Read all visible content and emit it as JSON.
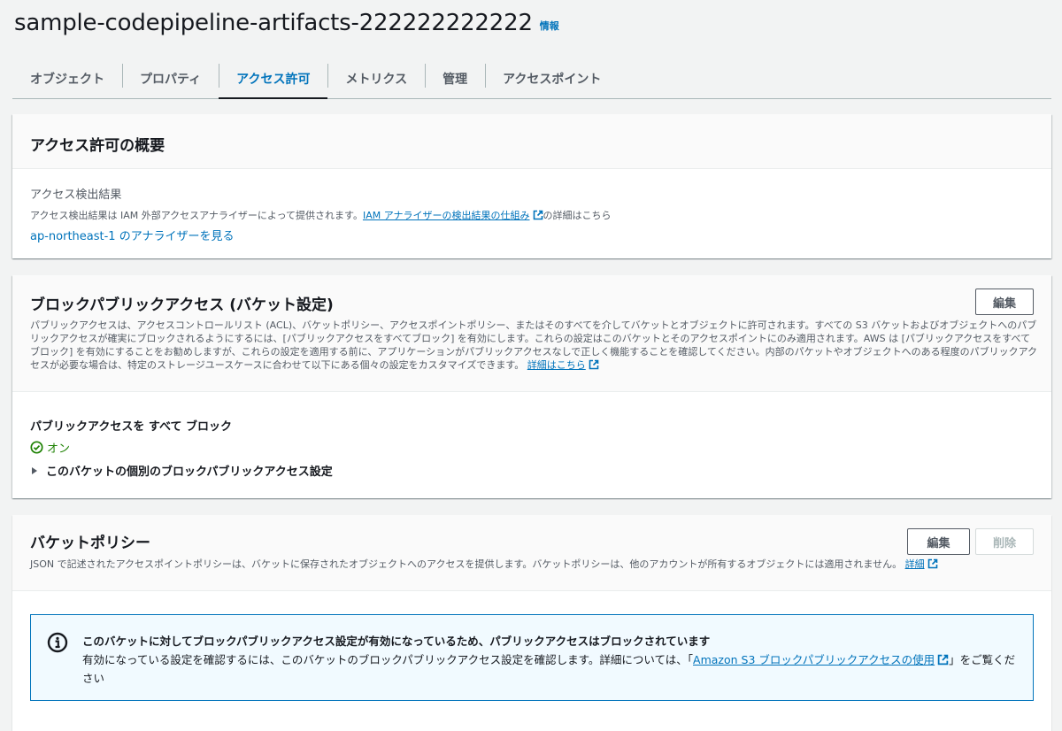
{
  "header": {
    "title": "sample-codepipeline-artifacts-222222222222",
    "info": "情報"
  },
  "tabs": [
    {
      "label": "オブジェクト",
      "active": false
    },
    {
      "label": "プロパティ",
      "active": false
    },
    {
      "label": "アクセス許可",
      "active": true
    },
    {
      "label": "メトリクス",
      "active": false
    },
    {
      "label": "管理",
      "active": false
    },
    {
      "label": "アクセスポイント",
      "active": false
    }
  ],
  "overview": {
    "title": "アクセス許可の概要",
    "findings_label": "アクセス検出結果",
    "findings_desc_prefix": "アクセス検出結果は IAM 外部アクセスアナライザーによって提供されます。",
    "findings_desc_link": "IAM アナライザーの検出結果の仕組み",
    "findings_desc_suffix": "の詳細はこちら",
    "analyzer_link": "ap-northeast-1 のアナライザーを見る"
  },
  "bpa": {
    "title": "ブロックパブリックアクセス (バケット設定)",
    "edit_label": "編集",
    "description": "パブリックアクセスは、アクセスコントロールリスト (ACL)、バケットポリシー、アクセスポイントポリシー、またはそのすべてを介してバケットとオブジェクトに許可されます。すべての S3 バケットおよびオブジェクトへのパブリックアクセスが確実にブロックされるようにするには、[パブリックアクセスをすべてブロック] を有効にします。これらの設定はこのバケットとそのアクセスポイントにのみ適用されます。AWS は [パブリックアクセスをすべてブロック] を有効にすることをお勧めしますが、これらの設定を適用する前に、アプリケーションがパブリックアクセスなしで正しく機能することを確認してください。内部のパケットやオブジェクトへのある程度のパブリックアクセスが必要な場合は、特定のストレージユースケースに合わせて以下にある個々の設定をカスタマイズできます。",
    "learn_more": "詳細はこちら",
    "block_all_label": "パブリックアクセスを すべて ブロック",
    "status": "オン",
    "expander": "このバケットの個別のブロックパブリックアクセス設定"
  },
  "policy": {
    "title": "バケットポリシー",
    "edit_label": "編集",
    "delete_label": "削除",
    "description": "JSON で記述されたアクセスポイントポリシーは、バケットに保存されたオブジェクトへのアクセスを提供します。バケットポリシーは、他のアカウントが所有するオブジェクトには適用されません。",
    "learn_more": "詳細",
    "alert": {
      "title": "このバケットに対してブロックパブリックアクセス設定が有効になっているため、パブリックアクセスはブロックされています",
      "text_prefix": "有効になっている設定を確認するには、このバケットのブロックパブリックアクセス設定を確認します。詳細については、「",
      "link": "Amazon S3 ブロックパブリックアクセスの使用",
      "text_suffix": "」をご覧ください"
    }
  },
  "colors": {
    "link": "#0073bb",
    "success": "#1d8102",
    "tab_active": "#0073bb",
    "alert_bg": "#f1faff",
    "alert_border": "#0073bb"
  }
}
